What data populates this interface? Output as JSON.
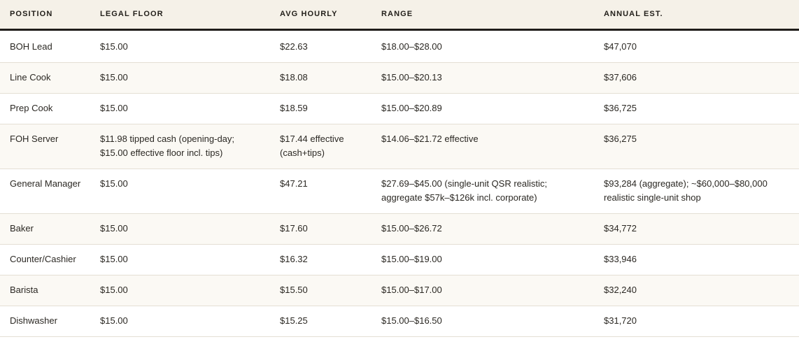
{
  "table": {
    "headers": [
      "POSITION",
      "LEGAL FLOOR",
      "AVG HOURLY",
      "RANGE",
      "ANNUAL EST."
    ],
    "rows": [
      [
        "BOH Lead",
        "$15.00",
        "$22.63",
        "$18.00–$28.00",
        "$47,070"
      ],
      [
        "Line Cook",
        "$15.00",
        "$18.08",
        "$15.00–$20.13",
        "$37,606"
      ],
      [
        "Prep Cook",
        "$15.00",
        "$18.59",
        "$15.00–$20.89",
        "$36,725"
      ],
      [
        "FOH Server",
        "$11.98 tipped cash (opening-day; $15.00 effective floor incl. tips)",
        "$17.44 effective (cash+tips)",
        "$14.06–$21.72 effective",
        "$36,275"
      ],
      [
        "General Manager",
        "$15.00",
        "$47.21",
        "$27.69–$45.00 (single-unit QSR realistic; aggregate $57k–$126k incl. corporate)",
        "$93,284 (aggregate); ~$60,000–$80,000 realistic single-unit shop"
      ],
      [
        "Baker",
        "$15.00",
        "$17.60",
        "$15.00–$26.72",
        "$34,772"
      ],
      [
        "Counter/Cashier",
        "$15.00",
        "$16.32",
        "$15.00–$19.00",
        "$33,946"
      ],
      [
        "Barista",
        "$15.00",
        "$15.50",
        "$15.00–$17.00",
        "$32,240"
      ],
      [
        "Dishwasher",
        "$15.00",
        "$15.25",
        "$15.00–$16.50",
        "$31,720"
      ]
    ]
  }
}
